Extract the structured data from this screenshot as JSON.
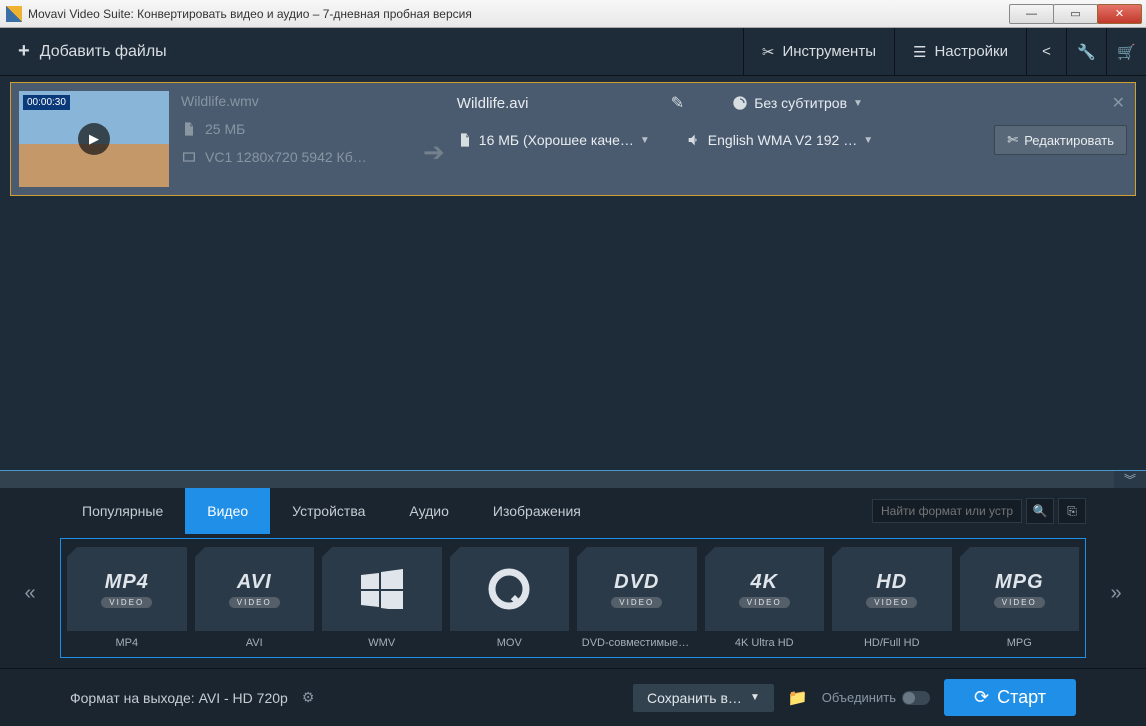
{
  "window": {
    "title": "Movavi Video Suite: Конвертировать видео и аудио – 7-дневная пробная версия"
  },
  "toolbar": {
    "add_files": "Добавить файлы",
    "tools": "Инструменты",
    "settings": "Настройки"
  },
  "file": {
    "timecode": "00:00:30",
    "src_name": "Wildlife.wmv",
    "src_size": "25 МБ",
    "src_details": "VC1 1280x720 5942 Кб…",
    "out_name": "Wildlife.avi",
    "out_size_quality": "16 МБ (Хорошее каче…",
    "subtitles": "Без субтитров",
    "audio": "English WMA V2 192 …",
    "edit": "Редактировать"
  },
  "tabs": [
    "Популярные",
    "Видео",
    "Устройства",
    "Аудио",
    "Изображения"
  ],
  "search_placeholder": "Найти формат или устрой…",
  "formats": [
    {
      "big": "MP4",
      "tag": "VIDEO",
      "label": "MP4"
    },
    {
      "big": "AVI",
      "tag": "VIDEO",
      "label": "AVI"
    },
    {
      "big": "WIN",
      "tag": "",
      "label": "WMV"
    },
    {
      "big": "Q",
      "tag": "",
      "label": "MOV"
    },
    {
      "big": "DVD",
      "tag": "VIDEO",
      "label": "DVD-совместимые в…"
    },
    {
      "big": "4K",
      "tag": "VIDEO",
      "label": "4K Ultra HD"
    },
    {
      "big": "HD",
      "tag": "VIDEO",
      "label": "HD/Full HD"
    },
    {
      "big": "MPG",
      "tag": "VIDEO",
      "label": "MPG"
    }
  ],
  "bottom": {
    "output_label": "Формат на выходе: AVI - HD 720p",
    "save_to": "Сохранить в…",
    "merge": "Объединить",
    "start": "Старт"
  }
}
